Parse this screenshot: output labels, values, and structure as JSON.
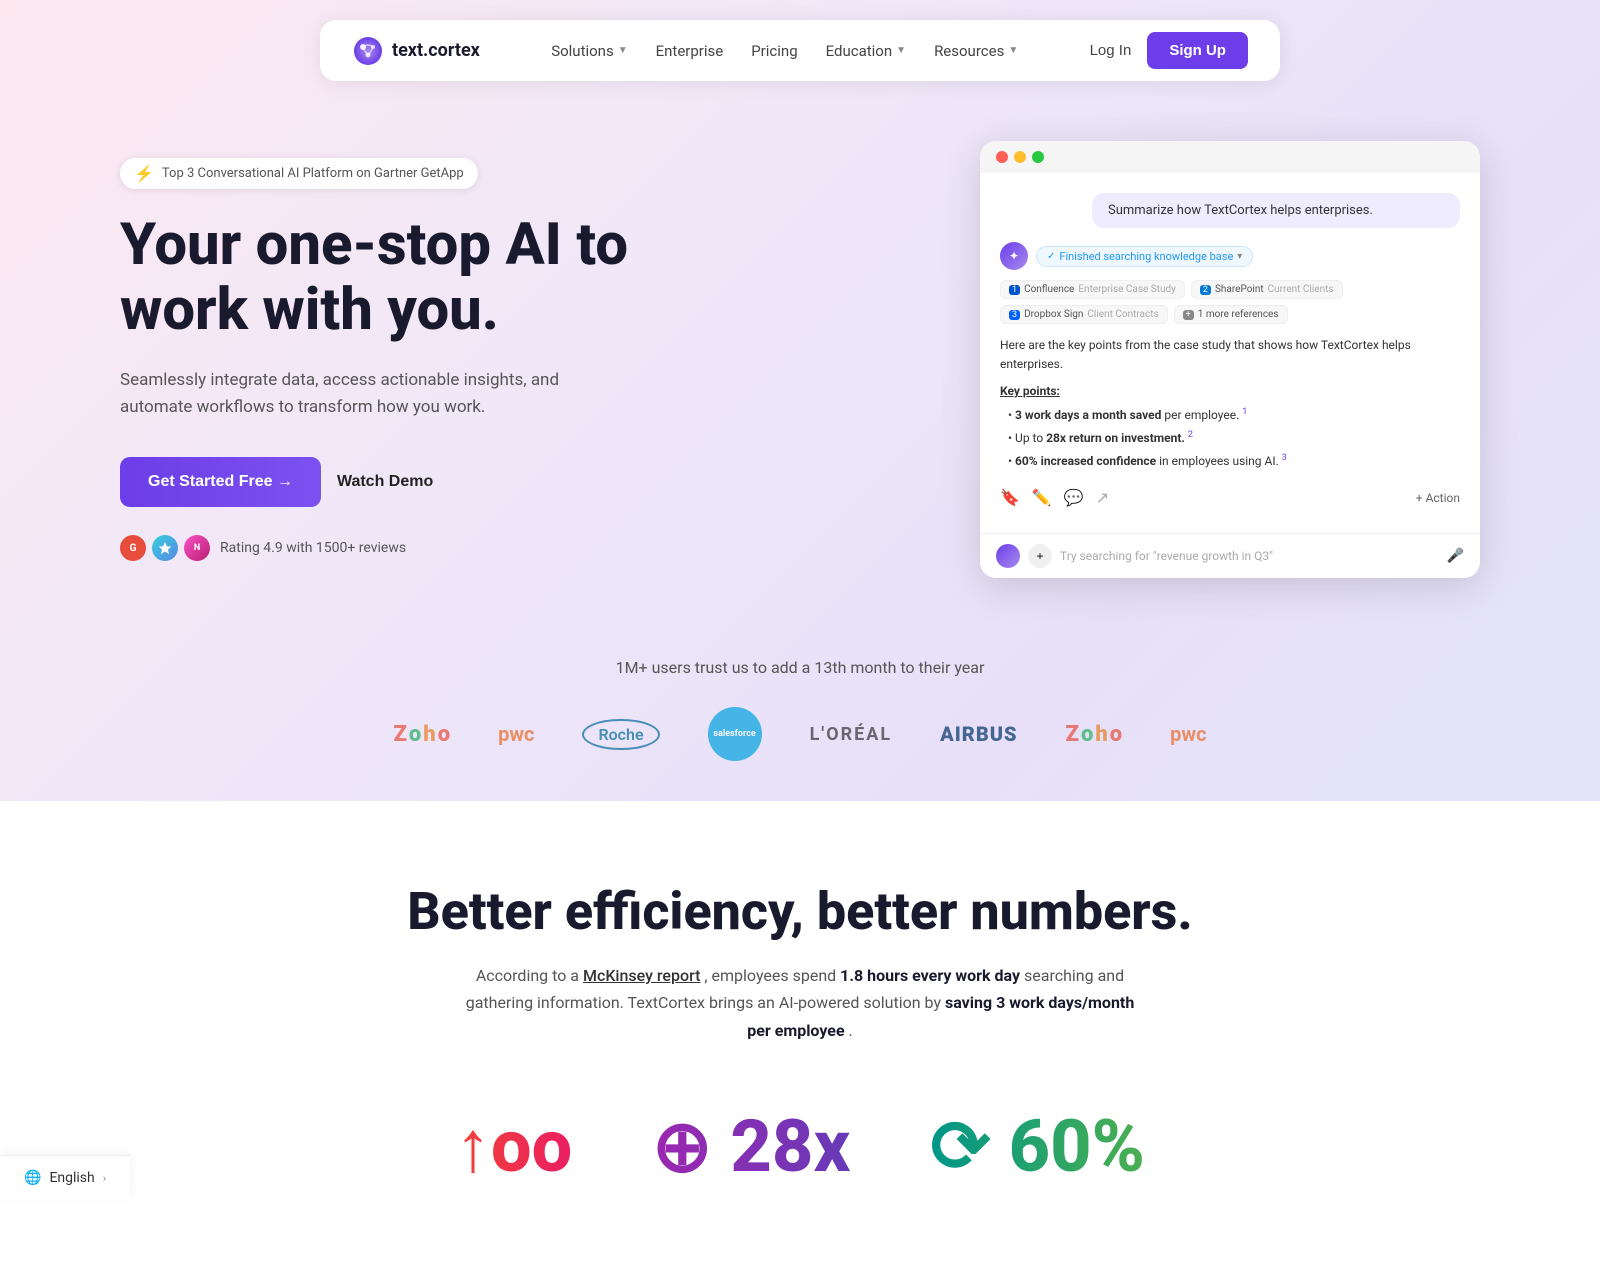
{
  "nav": {
    "logo_text": "text.cortex",
    "links": [
      {
        "label": "Solutions",
        "has_dropdown": true
      },
      {
        "label": "Enterprise",
        "has_dropdown": false
      },
      {
        "label": "Pricing",
        "has_dropdown": false
      },
      {
        "label": "Education",
        "has_dropdown": true
      },
      {
        "label": "Resources",
        "has_dropdown": true
      }
    ],
    "login_label": "Log In",
    "signup_label": "Sign Up"
  },
  "hero": {
    "badge_text": "Top 3 Conversational AI Platform on Gartner GetApp",
    "title_line1": "Your one-stop AI to",
    "title_line2": "work with you.",
    "subtitle": "Seamlessly integrate data, access actionable insights, and automate workflows to transform how you work.",
    "cta_primary": "Get Started Free →",
    "cta_secondary": "Watch Demo",
    "rating_text": "Rating 4.9 with 1500+ reviews"
  },
  "mockup": {
    "user_query": "Summarize how TextCortex helps enterprises.",
    "status": "Finished searching knowledge base",
    "sources": [
      {
        "num": "1",
        "label": "Confluence",
        "sub": "Enterprise Case Study",
        "type": "confluence"
      },
      {
        "num": "2",
        "label": "SharePoint",
        "sub": "Current Clients",
        "type": "sharepoint"
      },
      {
        "num": "3",
        "label": "Dropbox Sign",
        "sub": "Client Contracts",
        "type": "dropbox"
      },
      {
        "num": "+",
        "label": "1 more references",
        "type": "more"
      }
    ],
    "response_intro": "Here are the key points from the case study that shows how TextCortex helps enterprises.",
    "key_points_title": "Key points:",
    "key_points": [
      {
        "text": "3 work days a month saved",
        "highlight": "3 work days a month saved",
        "suffix": " per employee.",
        "num": "1"
      },
      {
        "text": "Up to 28x return on investment.",
        "prefix": "Up to ",
        "highlight": "28x return on investment.",
        "num": "2"
      },
      {
        "text": "60% increased confidence",
        "highlight": "60% increased confidence",
        "suffix": " in employees using AI.",
        "num": "3"
      }
    ],
    "input_placeholder": "Try searching for \"revenue growth in Q3\"",
    "action_label": "+ Action"
  },
  "trust": {
    "title": "1M+ users trust us to add a 13th month to their year",
    "logos": [
      "Zoho",
      "PwC",
      "Roche",
      "Salesforce",
      "L'ORÉAL",
      "AIRBUS",
      "Zoho",
      "PwC"
    ]
  },
  "better_section": {
    "title": "Better efficiency, better numbers.",
    "desc_prefix": "According to a ",
    "mckinsey_label": "McKinsey report",
    "desc_mid": ", employees spend ",
    "stat1": "1.8 hours every work day",
    "desc_mid2": " searching and gathering information. TextCortex brings an AI-powered solution by ",
    "stat2": "saving 3 work days/month per employee",
    "desc_end": "."
  },
  "footer": {
    "language": "English"
  }
}
